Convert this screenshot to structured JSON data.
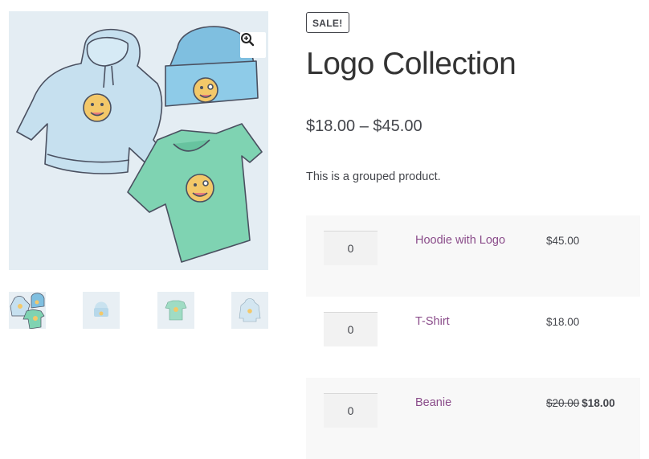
{
  "product": {
    "badge": "SALE!",
    "title": "Logo Collection",
    "price_range": "$18.00 – $45.00",
    "description": "This is a grouped product."
  },
  "gallery": {
    "zoom_icon": "magnifier-plus-icon",
    "main_image": "logo-collection-illustration",
    "thumbnails": [
      "logo-collection-thumbnail",
      "beanie-thumbnail",
      "tshirt-thumbnail",
      "hoodie-thumbnail"
    ]
  },
  "grouped_items": [
    {
      "quantity": "0",
      "name": "Hoodie with Logo",
      "price": "$45.00"
    },
    {
      "quantity": "0",
      "name": "T-Shirt",
      "price": "$18.00"
    },
    {
      "quantity": "0",
      "name": "Beanie",
      "regular_price": "$20.00",
      "sale_price": "$18.00"
    }
  ],
  "colors": {
    "link": "#8a4c8a",
    "text": "#43454b",
    "row_alt": "#f8f8f8",
    "image_bg": "#e4edf3"
  }
}
